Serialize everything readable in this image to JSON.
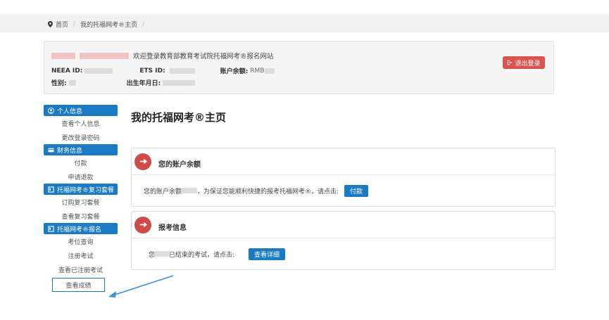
{
  "breadcrumb": {
    "home": "首页",
    "current": "我的托福网考®主页"
  },
  "header": {
    "welcome": "欢迎登录教育部教育考试院托福网考®报名网站",
    "neea_id_label": "NEEA ID:",
    "ets_id_label": "ETS ID:",
    "balance_label": "账户余额:",
    "balance_prefix": "RMB",
    "gender_label": "性别:",
    "birth_label": "出生年月日:",
    "logout_label": "退出登录"
  },
  "sidebar": {
    "sections": [
      {
        "title": "个人信息",
        "items": [
          "查看个人信息",
          "更改登录密码"
        ]
      },
      {
        "title": "财务信息",
        "items": [
          "付款",
          "申请退款"
        ]
      },
      {
        "title": "托福网考®复习套餐",
        "items": [
          "订购复习套餐",
          "查看复习套餐"
        ]
      },
      {
        "title": "托福网考®报名",
        "items": [
          "考位查询",
          "注册考试",
          "查看已注册考试",
          "查看成绩"
        ]
      }
    ]
  },
  "main": {
    "title": "我的托福网考®主页",
    "balance_card": {
      "title": "您的账户余额",
      "text_before": "您的账户余额",
      "text_after": "，为保证您能顺利快捷的报考托福网考®，请点击:",
      "button": "付款"
    },
    "exam_card": {
      "title": "报考信息",
      "text_before": "您",
      "text_after": "已结束的考试，请点击:",
      "button": "查看详细"
    }
  },
  "colors": {
    "primary": "#1a7bc4",
    "danger": "#d9534f",
    "card_icon": "#cf4b4b"
  },
  "icons": {
    "breadcrumb": "map-pin-icon",
    "logout": "logout-icon",
    "personal": "user-circle-icon",
    "finance": "credit-card-icon",
    "package": "book-icon",
    "register": "book-icon",
    "card": "arrow-right-icon"
  }
}
